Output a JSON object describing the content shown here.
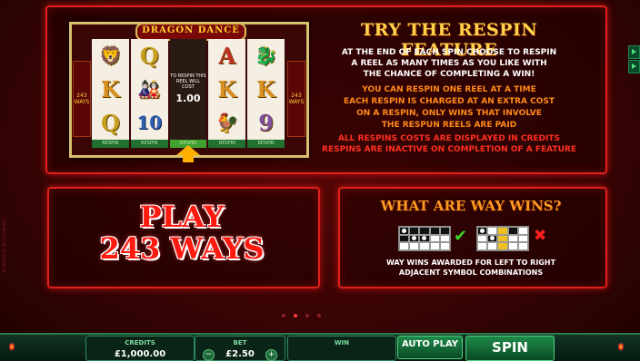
{
  "reels_title": "DRAGON DANCE",
  "ways_badge": "243 WAYS",
  "reels": [
    {
      "symbols": [
        "lion-dance",
        "K",
        "Q"
      ],
      "respin_label": "RESPIN",
      "held": false
    },
    {
      "symbols": [
        "Q",
        "dancer",
        "10"
      ],
      "respin_label": "RESPIN",
      "held": false
    },
    {
      "symbols": [],
      "respin_label": "RESPIN",
      "held": true,
      "held_text": "TO RESPIN THIS REEL WILL COST",
      "held_value": "1.00"
    },
    {
      "symbols": [
        "A",
        "K",
        "rooster"
      ],
      "respin_label": "RESPIN",
      "held": false
    },
    {
      "symbols": [
        "dragon",
        "K",
        "9"
      ],
      "respin_label": "RESPIN",
      "held": false
    }
  ],
  "feature": {
    "title": "TRY THE RESPIN FEATURE",
    "white_lines": [
      "AT THE END OF EACH SPIN CHOOSE TO RESPIN",
      "A REEL AS MANY TIMES AS YOU LIKE WITH",
      "THE CHANCE OF COMPLETING A WIN!"
    ],
    "orange_lines": [
      "YOU CAN RESPIN ONE REEL AT A TIME",
      "EACH RESPIN IS CHARGED AT AN EXTRA COST",
      "ON A RESPIN, ONLY WINS THAT INVOLVE",
      "THE RESPUN REELS ARE PAID"
    ],
    "red_lines": [
      "ALL RESPINS COSTS ARE DISPLAYED IN CREDITS",
      "RESPINS ARE INACTIVE ON COMPLETION OF A FEATURE"
    ]
  },
  "play_ways": {
    "line1": "PLAY",
    "line2": "243 WAYS"
  },
  "way_wins": {
    "title": "WHAT ARE WAY WINS?",
    "desc_lines": [
      "WAY WINS AWARDED FOR LEFT TO RIGHT",
      "ADJACENT SYMBOL COMBINATIONS"
    ],
    "check_glyph": "✔",
    "cross_glyph": "✖"
  },
  "pager": {
    "count": 4,
    "active_index": 1
  },
  "bottom_bar": {
    "credits_label": "CREDITS",
    "credits_value": "£1,000.00",
    "bet_label": "BET",
    "bet_value": "£2.50",
    "bet_minus": "−",
    "bet_plus": "+",
    "win_label": "WIN",
    "win_value": "",
    "autoplay_label": "AUTO PLAY",
    "spin_label": "SPIN"
  },
  "side_text": "POWERED BY MICROGAMING™",
  "colors": {
    "accent_gold": "#ffd24a",
    "panel_border": "#e0201a",
    "orange": "#ff8a18",
    "red": "#ff3020",
    "bar_green": "#1e8a4a"
  }
}
